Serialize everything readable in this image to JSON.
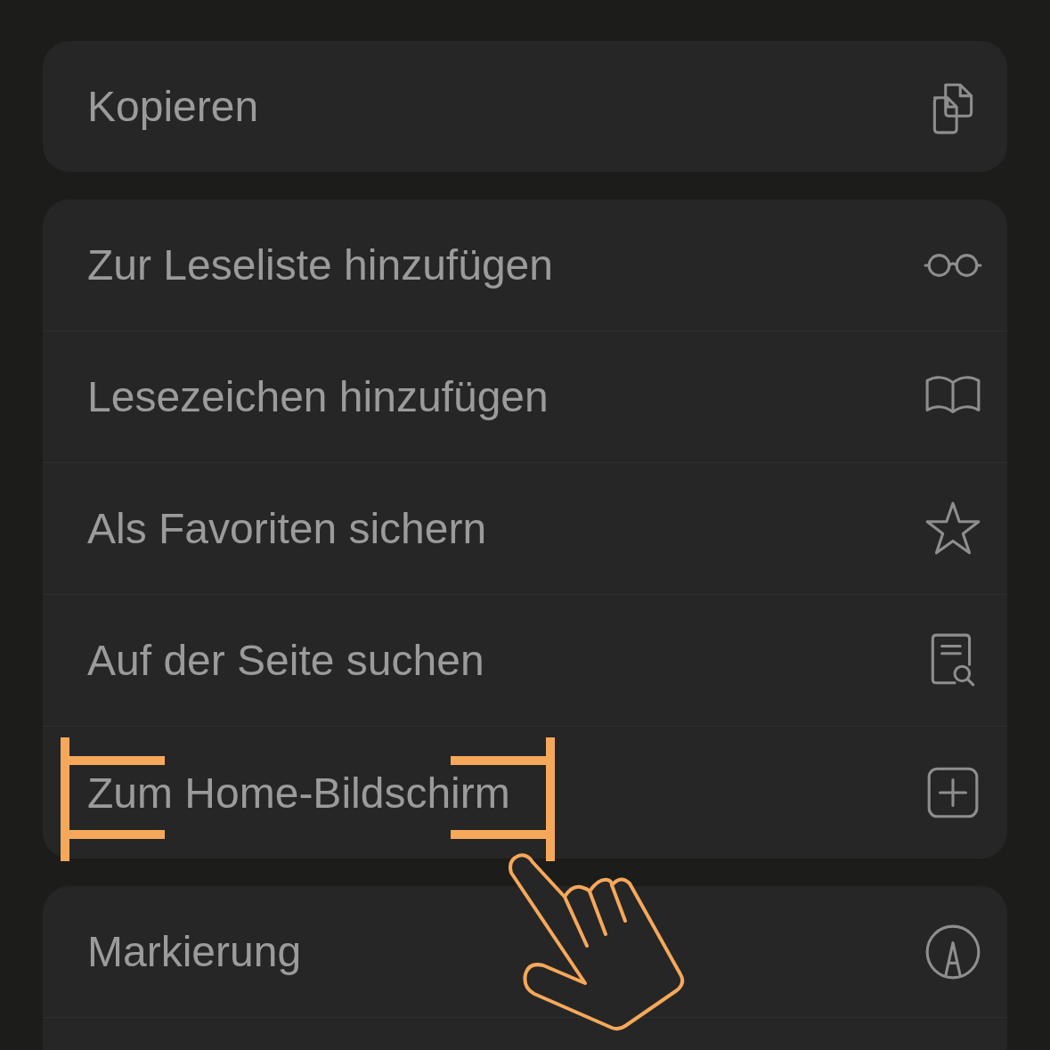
{
  "groups": [
    {
      "items": [
        {
          "label": "Kopieren",
          "kind": "copy",
          "highlighted": false
        }
      ]
    },
    {
      "items": [
        {
          "label": "Zur Leseliste hinzufügen",
          "kind": "glasses",
          "highlighted": false
        },
        {
          "label": "Lesezeichen hinzufügen",
          "kind": "book",
          "highlighted": false
        },
        {
          "label": "Als Favoriten sichern",
          "kind": "star",
          "highlighted": false
        },
        {
          "label": "Auf der Seite suchen",
          "kind": "find",
          "highlighted": false
        },
        {
          "label": "Zum Home-Bildschirm",
          "kind": "add",
          "highlighted": true
        }
      ]
    },
    {
      "items": [
        {
          "label": "Markierung",
          "kind": "markup",
          "highlighted": false
        }
      ]
    }
  ]
}
